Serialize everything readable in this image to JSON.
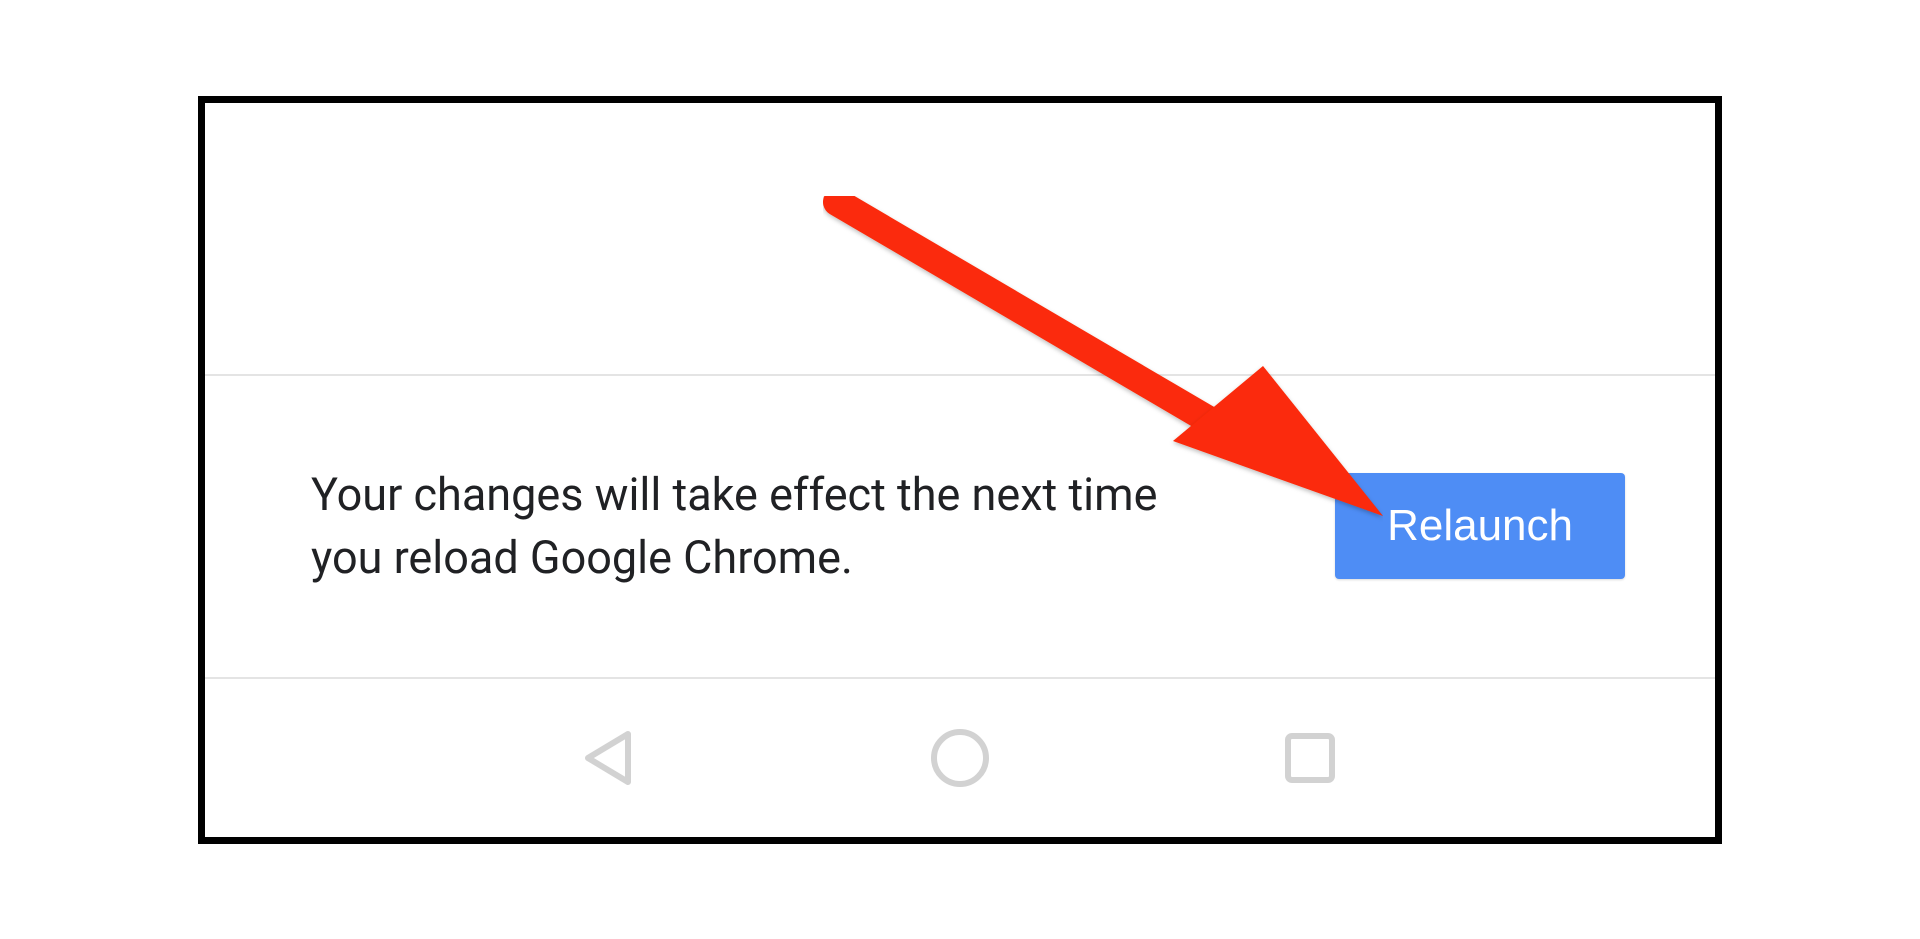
{
  "banner": {
    "message": "Your changes will take effect the next time you reload Google Chrome.",
    "button_label": "Relaunch"
  },
  "nav": {
    "back_label": "back-triangle-icon",
    "home_label": "home-circle-icon",
    "recent_label": "recent-square-icon"
  },
  "annotation": {
    "arrow_color": "#fb2a07",
    "target": "relaunch-button"
  }
}
